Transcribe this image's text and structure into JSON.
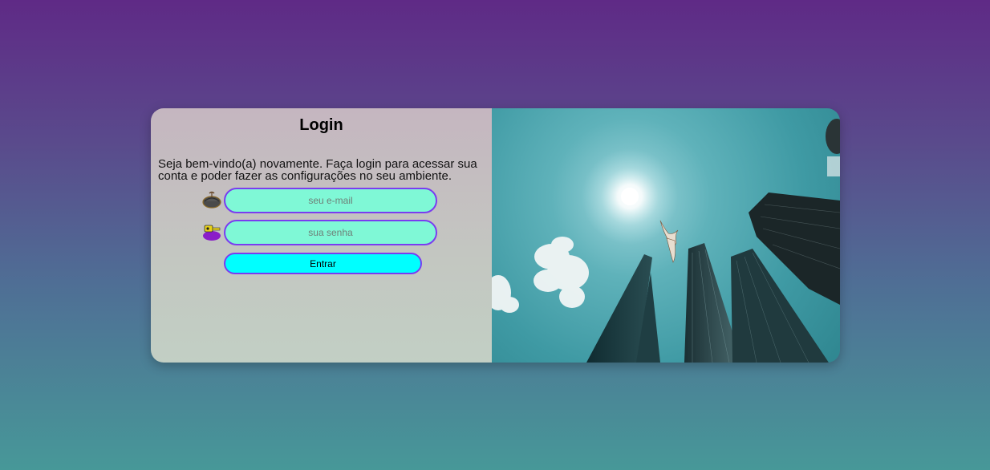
{
  "login": {
    "title": "Login",
    "welcome_text": "Seja bem-vindo(a) novamente. Faça login para acessar sua conta e poder fazer as configurações no seu ambiente.",
    "email": {
      "placeholder": "seu e-mail",
      "value": "",
      "icon": "mail-icon"
    },
    "password": {
      "placeholder": "sua senha",
      "value": "",
      "icon": "lock-icon"
    },
    "submit_label": "Entrar"
  },
  "side_image": {
    "subject": "skyscrapers-sky-photo"
  },
  "colors": {
    "input_bg": "#7ff8d6",
    "input_border": "#7a3cf0",
    "button_bg": "#00ffff",
    "panel_bg": "#c3c0c2"
  }
}
